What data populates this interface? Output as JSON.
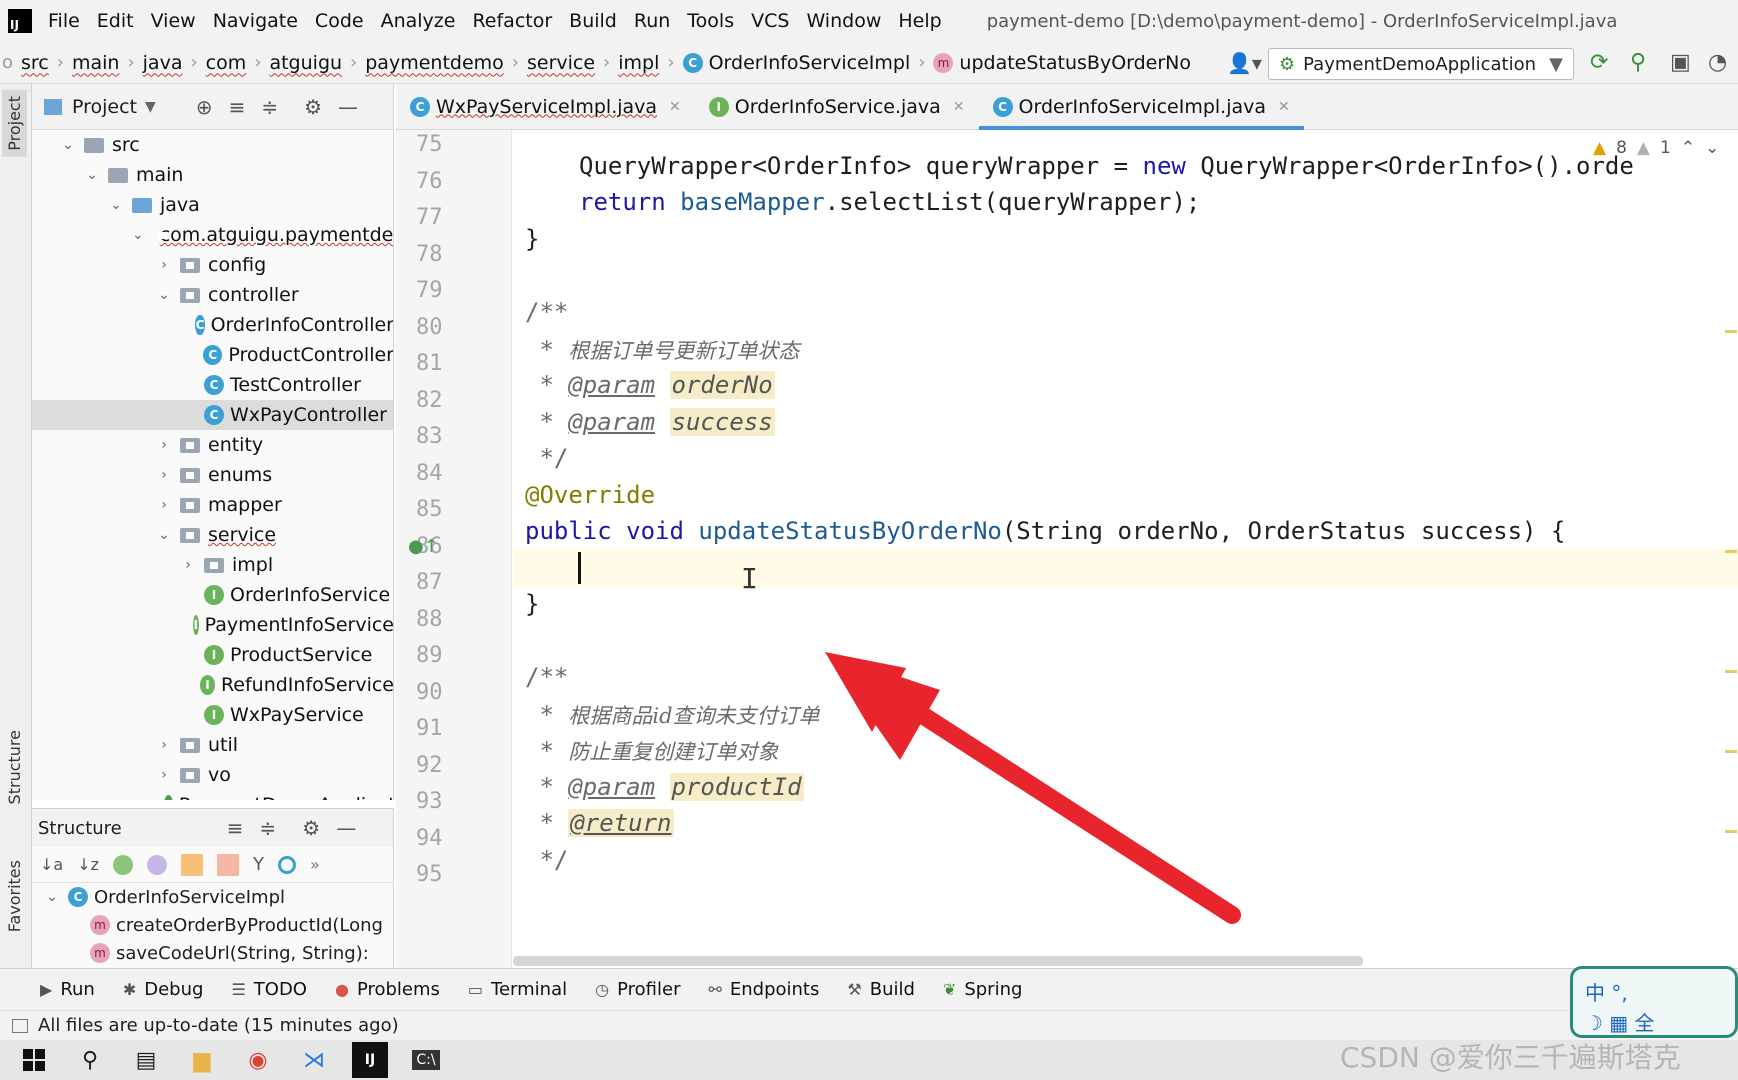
{
  "menubar": {
    "items": [
      "File",
      "Edit",
      "View",
      "Navigate",
      "Code",
      "Analyze",
      "Refactor",
      "Build",
      "Run",
      "Tools",
      "VCS",
      "Window",
      "Help"
    ],
    "window_title": "payment-demo [D:\\demo\\payment-demo] - OrderInfoServiceImpl.java"
  },
  "breadcrumbs": [
    "src",
    "main",
    "java",
    "com",
    "atguigu",
    "paymentdemo",
    "service",
    "impl",
    "OrderInfoServiceImpl",
    "updateStatusByOrderNo"
  ],
  "run_config": "PaymentDemoApplication",
  "left_strip": {
    "project_tab": "Project",
    "structure_tab": "Structure",
    "favorites_tab": "Favorites"
  },
  "project_panel": {
    "title": "Project",
    "tree": [
      {
        "label": "src",
        "kind": "folder",
        "expanded": true
      },
      {
        "label": "main",
        "kind": "folder",
        "expanded": true
      },
      {
        "label": "java",
        "kind": "folder-blue",
        "expanded": true
      },
      {
        "label": "com.atguigu.paymentdemo",
        "kind": "package",
        "expanded": true
      },
      {
        "label": "config",
        "kind": "package",
        "expanded": false
      },
      {
        "label": "controller",
        "kind": "package",
        "expanded": true
      },
      {
        "label": "OrderInfoController",
        "kind": "class"
      },
      {
        "label": "ProductController",
        "kind": "class"
      },
      {
        "label": "TestController",
        "kind": "class"
      },
      {
        "label": "WxPayController",
        "kind": "class",
        "selected": true
      },
      {
        "label": "entity",
        "kind": "package",
        "expanded": false
      },
      {
        "label": "enums",
        "kind": "package",
        "expanded": false
      },
      {
        "label": "mapper",
        "kind": "package",
        "expanded": false
      },
      {
        "label": "service",
        "kind": "package",
        "expanded": true
      },
      {
        "label": "impl",
        "kind": "package",
        "expanded": false
      },
      {
        "label": "OrderInfoService",
        "kind": "interface"
      },
      {
        "label": "PaymentInfoService",
        "kind": "interface"
      },
      {
        "label": "ProductService",
        "kind": "interface"
      },
      {
        "label": "RefundInfoService",
        "kind": "interface"
      },
      {
        "label": "WxPayService",
        "kind": "interface"
      },
      {
        "label": "util",
        "kind": "package",
        "expanded": false
      },
      {
        "label": "vo",
        "kind": "package",
        "expanded": false
      },
      {
        "label": "PaymentDemoApplication",
        "kind": "app"
      }
    ]
  },
  "structure_panel": {
    "title": "Structure",
    "items": [
      {
        "label": "OrderInfoServiceImpl",
        "kind": "class"
      },
      {
        "label": "createOrderByProductId(Long",
        "kind": "method"
      },
      {
        "label": "saveCodeUrl(String, String):",
        "kind": "method"
      }
    ]
  },
  "editor_tabs": [
    {
      "label": "WxPayServiceImpl.java",
      "icon": "class-icon",
      "active": false
    },
    {
      "label": "OrderInfoService.java",
      "icon": "interface-icon",
      "active": false
    },
    {
      "label": "OrderInfoServiceImpl.java",
      "icon": "class-icon",
      "active": true
    }
  ],
  "inspections": {
    "warnings": "8",
    "weak_warnings": "1"
  },
  "line_numbers": [
    "75",
    "76",
    "77",
    "78",
    "79",
    "80",
    "81",
    "82",
    "83",
    "84",
    "85",
    "86",
    "87",
    "88",
    "89",
    "90",
    "91",
    "92",
    "93",
    "94",
    "95"
  ],
  "code": {
    "l76_type": "QueryWrapper<OrderInfo>",
    "l76_var": " queryWrapper = ",
    "l76_new": "new",
    "l76_rest": " QueryWrapper<OrderInfo>().orde",
    "l77_return": "return",
    "l77_mapper": "baseMapper",
    "l77_rest": ".selectList(queryWrapper);",
    "l78": "}",
    "l80": "/**",
    "l81_star": " * ",
    "l81_text": "根据订单号更新订单状态",
    "l82_star": " * ",
    "l82_tag": "@param",
    "l82_param": "orderNo",
    "l83_star": " * ",
    "l83_tag": "@param",
    "l83_param": "success",
    "l84": " */",
    "l85": "@Override",
    "l86_public": "public",
    "l86_void": "void",
    "l86_name": "updateStatusByOrderNo",
    "l86_rest": "(String orderNo, OrderStatus success) {",
    "l88": "}",
    "l90": "/**",
    "l91_star": " * ",
    "l91_text": "根据商品id查询未支付订单",
    "l92_star": " * ",
    "l92_text": "防止重复创建订单对象",
    "l93_star": " * ",
    "l93_tag": "@param",
    "l93_param": "productId",
    "l94_star": " * ",
    "l94_tag": "@return",
    "l95": " */"
  },
  "bottom_tools": [
    "Run",
    "Debug",
    "TODO",
    "Problems",
    "Terminal",
    "Profiler",
    "Endpoints",
    "Build",
    "Spring"
  ],
  "status": "All files are up-to-date (15 minutes ago)",
  "watermark": "CSDN @爱你三千遍斯塔克",
  "ime": {
    "line1": "中 °, ",
    "line2": "全"
  },
  "colors": {
    "annotation_arrow": "#e8242c",
    "active_tab_underline": "#4a8ee0"
  }
}
